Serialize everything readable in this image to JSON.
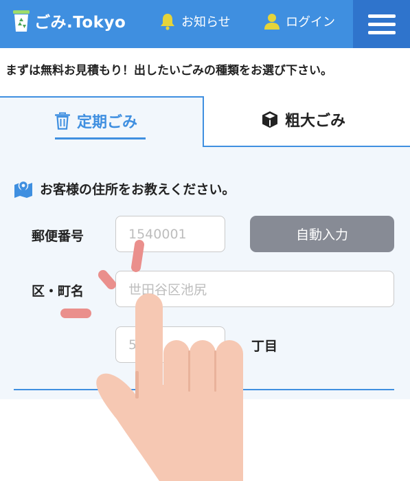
{
  "header": {
    "logo_text": "ごみ.Tokyo",
    "nav_notice": "お知らせ",
    "nav_login": "ログイン"
  },
  "instruction": "まずは無料お見積もり！出したいごみの種類をお選び下さい。",
  "tabs": [
    {
      "label": "定期ごみ",
      "active": true
    },
    {
      "label": "粗大ごみ",
      "active": false
    }
  ],
  "address_form": {
    "heading": "お客様の住所をお教えください。",
    "postal_label": "郵便番号",
    "postal_placeholder": "1540001",
    "auto_fill_button": "自動入力",
    "area_label": "区・町名",
    "area_placeholder": "世田谷区池尻",
    "chome_placeholder": "5",
    "chome_suffix": "丁目"
  },
  "colors": {
    "brand_blue": "#3f8fe0",
    "menu_blue": "#2f74cc",
    "button_gray": "#878b95",
    "bell_yellow": "#e5d43a",
    "tap_mark": "#ea8f8c",
    "hand_skin": "#f6c8b3"
  },
  "icons": {
    "logo": "recycle-bin-icon",
    "notice": "bell-icon",
    "login": "user-icon",
    "menu": "hamburger-icon",
    "tab_regular": "trash-icon",
    "tab_oversize": "box-icon",
    "heading": "map-pin-icon",
    "gesture": "tap-hand-icon"
  }
}
